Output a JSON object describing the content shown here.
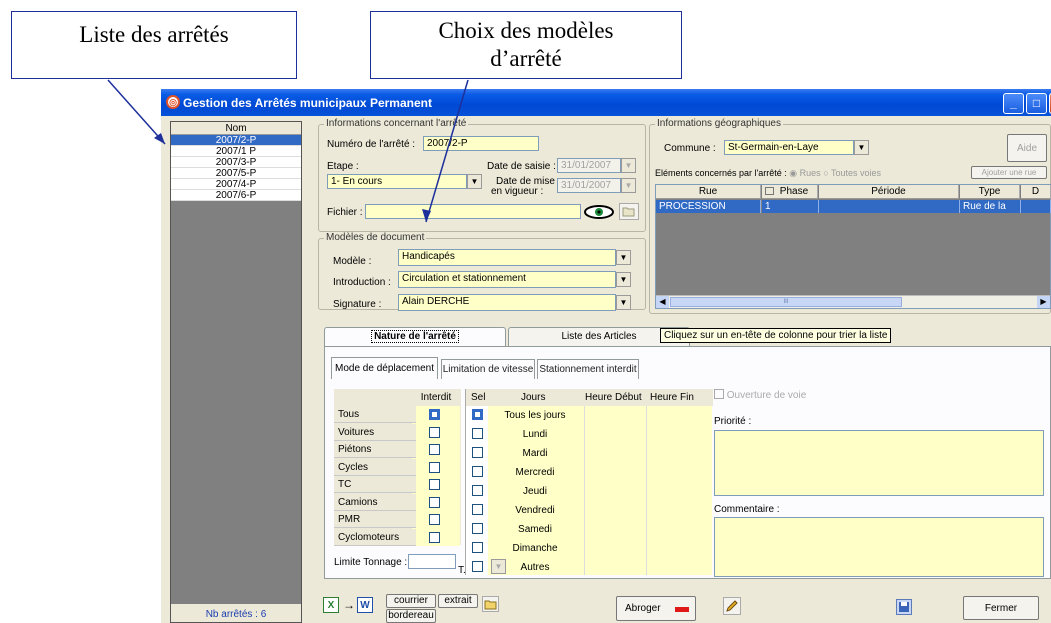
{
  "callouts": {
    "liste": "Liste des arrêtés",
    "choix_line1": "Choix des modèles",
    "choix_line2": "d’arrêté"
  },
  "window": {
    "title": "Gestion des Arrêtés municipaux Permanent",
    "min": "_",
    "max": "□",
    "close": "X"
  },
  "list": {
    "header": "Nom",
    "rows": [
      "2007/2-P",
      "2007/1 P",
      "2007/3-P",
      "2007/5-P",
      "2007/4-P",
      "2007/6-P"
    ],
    "footer": "Nb arrêtés : 6"
  },
  "info": {
    "legend": "Informations concernant l'arrêté",
    "numero_label": "Numéro  de l'arrêté :",
    "numero_value": "2007/2-P",
    "etape_label": "Etape :",
    "etape_value": "1- En cours",
    "saisie_label": "Date de saisie :",
    "saisie_value": "31/01/2007",
    "vigueur_label1": "Date de mise",
    "vigueur_label2": "en vigueur :",
    "vigueur_value": "31/01/2007",
    "fichier_label": "Fichier :",
    "fichier_value": ""
  },
  "models": {
    "legend": "Modèles de document",
    "modele_label": "Modèle :",
    "modele_value": "Handicapés",
    "intro_label": "Introduction :",
    "intro_value": "Circulation et stationnement",
    "signature_label": "Signature :",
    "signature_value": "Alain DERCHE"
  },
  "geo": {
    "legend": "Informations géographiques",
    "commune_label": "Commune :",
    "commune_value": "St-Germain-en-Laye",
    "aide_label": "Aide",
    "elements_label": "Eléments concernés par l'arrêté :",
    "rues_label": "Rues",
    "toutes_label": "Toutes voies",
    "ajouter_label": "Ajouter une rue",
    "columns": [
      "Rue",
      "Phase",
      "Période",
      "Type",
      "D"
    ],
    "row": [
      "PROCESSION",
      "1",
      "",
      "Rue de la",
      ""
    ],
    "scroll_mid": "III"
  },
  "tabs": {
    "nature": "Nature de l'arrêté",
    "articles": "Liste des Articles",
    "tooltip": "Cliquez sur un en-tête de colonne pour trier la liste"
  },
  "subtabs": [
    "Mode de déplacement",
    "Limitation de vitesse",
    "Stationnement interdit"
  ],
  "modes": {
    "interdit_header": "Interdit",
    "items": [
      "Tous",
      "Voitures",
      "Piétons",
      "Cycles",
      "TC",
      "Camions",
      "PMR",
      "Cyclomoteurs"
    ]
  },
  "days": {
    "sel_header": "Sel",
    "jours_header": "Jours",
    "debut_header": "Heure Début",
    "fin_header": "Heure Fin",
    "items": [
      "Tous les jours",
      "Lundi",
      "Mardi",
      "Mercredi",
      "Jeudi",
      "Vendredi",
      "Samedi",
      "Dimanche",
      "Autres"
    ]
  },
  "limite": {
    "label": "Limite Tonnage :",
    "unit": "T."
  },
  "right": {
    "ouverture_label": "Ouverture de voie",
    "priorite_label": "Priorité :",
    "commentaire_label": "Commentaire :"
  },
  "bottom": {
    "courrier": "courrier",
    "extrait": "extrait",
    "bordereau": "bordereau",
    "abroger": "Abroger",
    "fermer": "Fermer",
    "arrow": "→"
  },
  "colors": {
    "accent": "#316ac5",
    "field": "#ffffc8",
    "window_bg": "#ece9d8",
    "callout_border": "#1d2f9b"
  }
}
